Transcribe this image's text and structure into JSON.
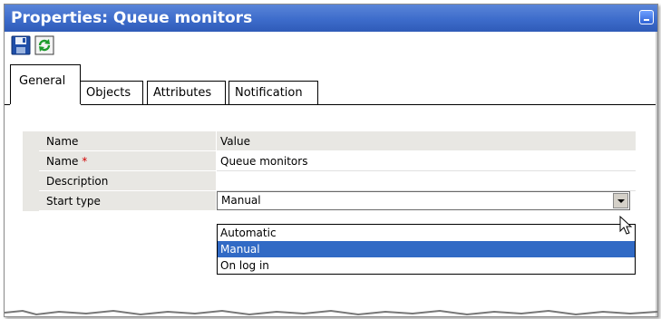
{
  "window": {
    "title": "Properties: Queue monitors"
  },
  "toolbar": {
    "save_icon": "floppy-disk-icon",
    "refresh_icon": "refresh-icon"
  },
  "tabs": [
    {
      "label": "General",
      "active": true
    },
    {
      "label": "Objects",
      "active": false
    },
    {
      "label": "Attributes",
      "active": false
    },
    {
      "label": "Notification",
      "active": false
    }
  ],
  "grid": {
    "header": {
      "name": "Name",
      "value": "Value"
    },
    "rows": [
      {
        "name": "Name",
        "required": "*",
        "value": "Queue monitors"
      },
      {
        "name": "Description",
        "value": ""
      },
      {
        "name": "Start type",
        "value": "Manual"
      }
    ]
  },
  "dropdown": {
    "options": [
      "Automatic",
      "Manual",
      "On log in"
    ],
    "selected": "Manual"
  },
  "colors": {
    "title_bar": "#3d6ccb",
    "selection": "#316ac5",
    "grid_shade": "#e8e7e3",
    "required": "#d00000"
  }
}
